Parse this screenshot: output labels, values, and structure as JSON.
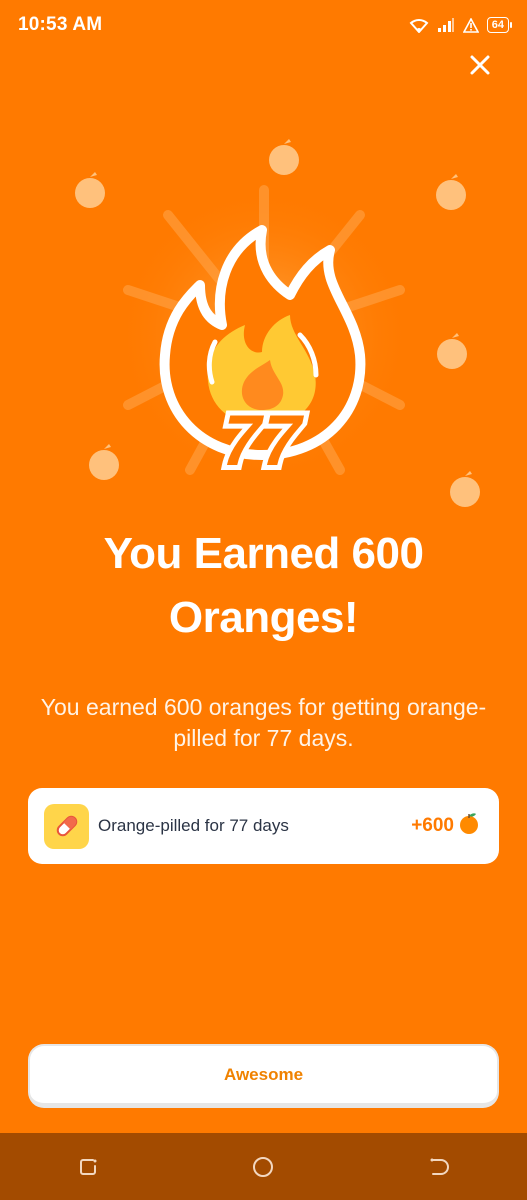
{
  "status_bar": {
    "time": "10:53 AM",
    "battery": "64",
    "icons": [
      "wifi-icon",
      "signal-icon",
      "alert-icon",
      "battery-icon"
    ]
  },
  "close_icon": "close-icon",
  "hero": {
    "badge_number": "77",
    "icons": [
      "flame-icon",
      "orange-fruit-icon"
    ]
  },
  "title": {
    "line1": "You Earned 600",
    "line2": "Oranges!"
  },
  "subtitle": "You earned 600 oranges for getting orange-pilled for 77 days.",
  "reward": {
    "icon": "pill-icon",
    "label": "Orange-pilled for 77 days",
    "amount": "+600",
    "amount_icon": "orange-icon"
  },
  "primary_button": "Awesome",
  "nav_bar": {
    "icons": [
      "recent-apps-icon",
      "home-icon",
      "back-icon"
    ]
  },
  "colors": {
    "background": "#FF7A00",
    "accent": "#FF7A00",
    "card": "#FFFFFF",
    "flame_inner": "#FFC933",
    "nav_bar": "#A34B00"
  }
}
